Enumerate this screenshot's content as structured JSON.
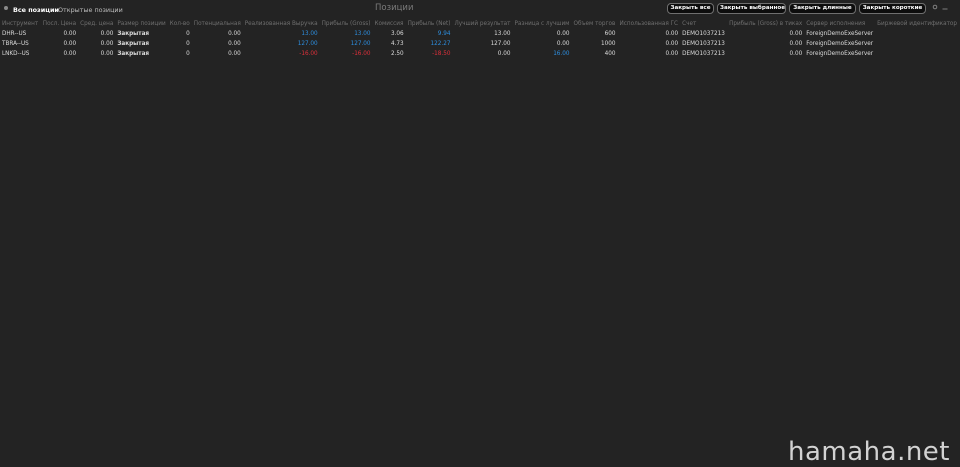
{
  "tabs": [
    {
      "label": "Все позиции",
      "active": true
    },
    {
      "label": "Открытые позиции",
      "active": false
    }
  ],
  "panel_title": "Позиции",
  "buttons": {
    "close_all": "Закрыть все",
    "close_selected": "Закрыть выбранное",
    "close_long": "Закрыть длинные",
    "close_short": "Закрыть короткие"
  },
  "controls": {
    "settings_icon": "gear-icon",
    "minimize_icon": "minimize-icon"
  },
  "table": {
    "columns": [
      "Инструмент",
      "Посл. Цена",
      "Сред. цена",
      "Размер позиции",
      "Кол-во",
      "Потенциальная",
      "Реализованная Выручка",
      "Прибыль (Gross)",
      "Комиссия",
      "Прибыль (Net)",
      "Лучший результат",
      "Разница с лучшим",
      "Объем торгов",
      "Использованная ГС",
      "Счет",
      "Прибыль (Gross) в тиках",
      "Сервер исполнения",
      "Биржевой идентификатор"
    ],
    "rows": [
      {
        "instrument": "DHR--US",
        "last_price": "0.00",
        "avg_price": "0.00",
        "position_size": "Закрытая",
        "qty": "0",
        "potential": "0.00",
        "realized": "13.00",
        "gross": "13.00",
        "commission": "3.06",
        "net": "9.94",
        "best": "13.00",
        "diff_best": "0.00",
        "volume": "600",
        "used_gs": "0.00",
        "account": "DEMO1037213",
        "gross_ticks": "0.00",
        "server": "ForeignDemoExeServer",
        "exchange_id": ""
      },
      {
        "instrument": "TBRA--US",
        "last_price": "0.00",
        "avg_price": "0.00",
        "position_size": "Закрытая",
        "qty": "0",
        "potential": "0.00",
        "realized": "127.00",
        "gross": "127.00",
        "commission": "4.73",
        "net": "122.27",
        "best": "127.00",
        "diff_best": "0.00",
        "volume": "1000",
        "used_gs": "0.00",
        "account": "DEMO1037213",
        "gross_ticks": "0.00",
        "server": "ForeignDemoExeServer",
        "exchange_id": ""
      },
      {
        "instrument": "LNKD--US",
        "last_price": "0.00",
        "avg_price": "0.00",
        "position_size": "Закрытая",
        "qty": "0",
        "potential": "0.00",
        "realized": "-16.00",
        "gross": "-16.00",
        "commission": "2.50",
        "net": "-18.50",
        "best": "0.00",
        "diff_best": "16.00",
        "volume": "400",
        "used_gs": "0.00",
        "account": "DEMO1037213",
        "gross_ticks": "0.00",
        "server": "ForeignDemoExeServer",
        "exchange_id": ""
      }
    ]
  },
  "watermark": "hamaha.net",
  "colors": {
    "background": "#232323",
    "positive": "#2d8fe0",
    "negative": "#e0303a",
    "header_text": "#6f6f6f"
  }
}
